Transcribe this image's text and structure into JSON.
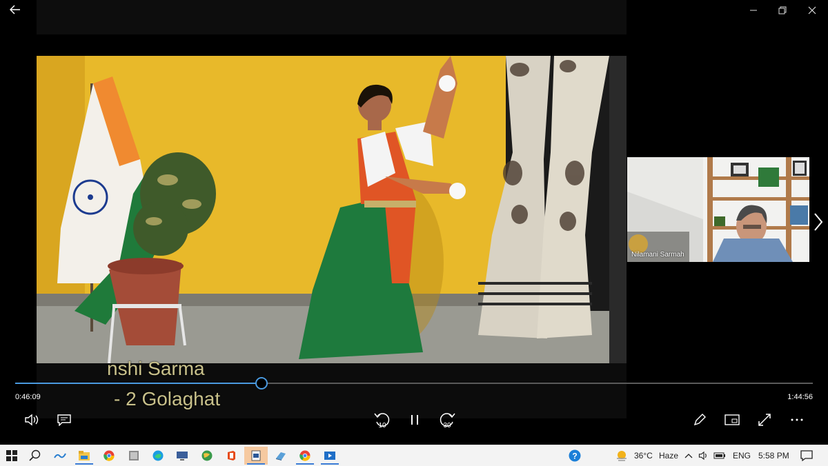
{
  "player": {
    "caption_line1": "nshi Sarma",
    "caption_line2": "- 2 Golaghat",
    "participant_name": "Nilamani Sarmah",
    "current_time": "0:46:09",
    "total_time": "1:44:56",
    "progress": 0.309,
    "rewind_seconds": "10",
    "forward_seconds": "30"
  },
  "taskbar": {
    "weather_temp": "36°C",
    "weather_desc": "Haze",
    "language": "ENG",
    "clock": "5:58 PM"
  },
  "colors": {
    "accent": "#4a9ae0",
    "video_wall": "#e8b92a"
  }
}
